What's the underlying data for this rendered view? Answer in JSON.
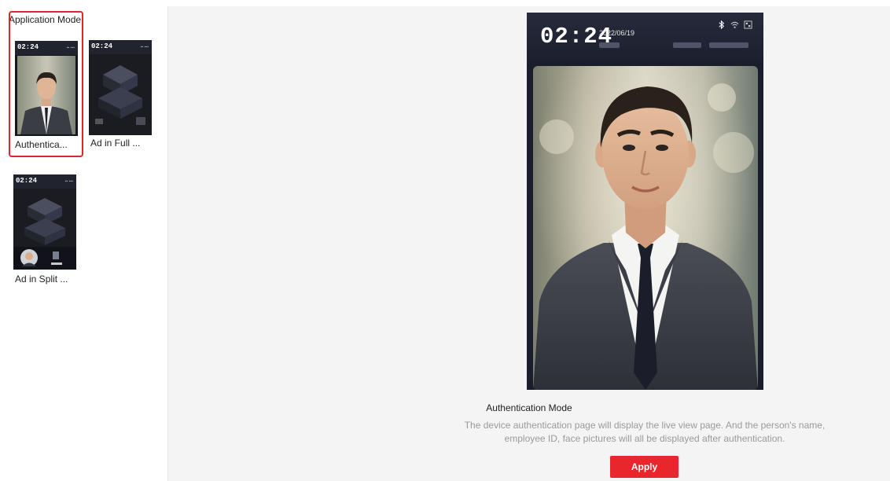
{
  "sidebar": {
    "title": "Application Mode",
    "modes": [
      {
        "label": "Authentica...",
        "time": "02:24",
        "selected": true
      },
      {
        "label": "Ad in Full ...",
        "time": "02:24",
        "selected": false
      },
      {
        "label": "Ad in Split ...",
        "time": "02:24",
        "selected": false
      }
    ]
  },
  "preview": {
    "time": "02:24",
    "date": "2022/06/19",
    "icons": [
      "bluetooth-icon",
      "wifi-icon",
      "qr-code-icon"
    ],
    "mode_title": "Authentication Mode",
    "description": "The device authentication page will display the live view page. And the person's name, employee ID, face pictures will all be displayed after authentication.",
    "apply_label": "Apply"
  },
  "colors": {
    "accent": "#e8262b",
    "device_bg": "#1a1d2b",
    "preview_bg": "#f4f4f5"
  }
}
